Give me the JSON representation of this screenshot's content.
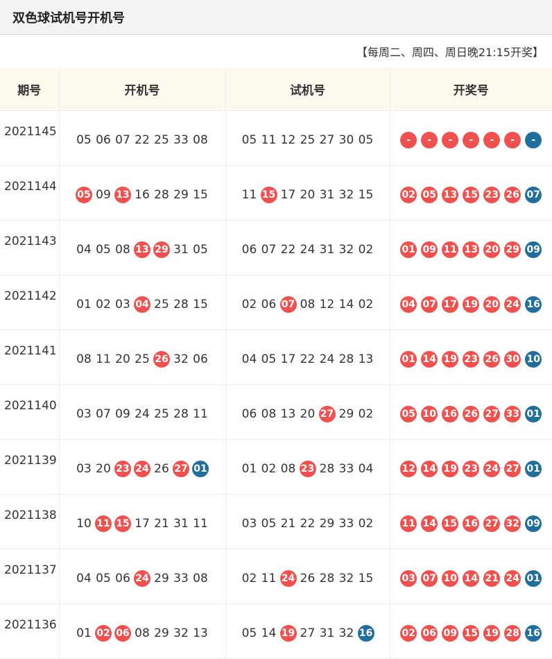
{
  "title": "双色球试机号开机号",
  "schedule": "【每周二、周四、周日晚21:15开奖】",
  "colors": {
    "red_ball": "#f0504e",
    "blue_ball": "#1f6e9b",
    "header_bg": "#fdf9ef"
  },
  "headers": [
    "期号",
    "开机号",
    "试机号",
    "开奖号"
  ],
  "rows": [
    {
      "issue": "2021145",
      "open": [
        [
          "05",
          ""
        ],
        [
          "06",
          ""
        ],
        [
          "07",
          ""
        ],
        [
          "22",
          ""
        ],
        [
          "25",
          ""
        ],
        [
          "33",
          ""
        ],
        [
          "08",
          ""
        ]
      ],
      "trial": [
        [
          "05",
          ""
        ],
        [
          "11",
          ""
        ],
        [
          "12",
          ""
        ],
        [
          "25",
          ""
        ],
        [
          "27",
          ""
        ],
        [
          "30",
          ""
        ],
        [
          "05",
          ""
        ]
      ],
      "draw": [
        [
          "-",
          "red"
        ],
        [
          "-",
          "red"
        ],
        [
          "-",
          "red"
        ],
        [
          "-",
          "red"
        ],
        [
          "-",
          "red"
        ],
        [
          "-",
          "red"
        ],
        [
          "-",
          "blue"
        ]
      ]
    },
    {
      "issue": "2021144",
      "open": [
        [
          "05",
          "red"
        ],
        [
          "09",
          ""
        ],
        [
          "13",
          "red"
        ],
        [
          "16",
          ""
        ],
        [
          "28",
          ""
        ],
        [
          "29",
          ""
        ],
        [
          "15",
          ""
        ]
      ],
      "trial": [
        [
          "11",
          ""
        ],
        [
          "15",
          "red"
        ],
        [
          "17",
          ""
        ],
        [
          "20",
          ""
        ],
        [
          "31",
          ""
        ],
        [
          "32",
          ""
        ],
        [
          "15",
          ""
        ]
      ],
      "draw": [
        [
          "02",
          "red"
        ],
        [
          "05",
          "red"
        ],
        [
          "13",
          "red"
        ],
        [
          "15",
          "red"
        ],
        [
          "23",
          "red"
        ],
        [
          "26",
          "red"
        ],
        [
          "07",
          "blue"
        ]
      ]
    },
    {
      "issue": "2021143",
      "open": [
        [
          "04",
          ""
        ],
        [
          "05",
          ""
        ],
        [
          "08",
          ""
        ],
        [
          "13",
          "red"
        ],
        [
          "29",
          "red"
        ],
        [
          "31",
          ""
        ],
        [
          "05",
          ""
        ]
      ],
      "trial": [
        [
          "06",
          ""
        ],
        [
          "07",
          ""
        ],
        [
          "22",
          ""
        ],
        [
          "24",
          ""
        ],
        [
          "31",
          ""
        ],
        [
          "32",
          ""
        ],
        [
          "02",
          ""
        ]
      ],
      "draw": [
        [
          "01",
          "red"
        ],
        [
          "09",
          "red"
        ],
        [
          "11",
          "red"
        ],
        [
          "13",
          "red"
        ],
        [
          "20",
          "red"
        ],
        [
          "29",
          "red"
        ],
        [
          "09",
          "blue"
        ]
      ]
    },
    {
      "issue": "2021142",
      "open": [
        [
          "01",
          ""
        ],
        [
          "02",
          ""
        ],
        [
          "03",
          ""
        ],
        [
          "04",
          "red"
        ],
        [
          "25",
          ""
        ],
        [
          "28",
          ""
        ],
        [
          "15",
          ""
        ]
      ],
      "trial": [
        [
          "02",
          ""
        ],
        [
          "06",
          ""
        ],
        [
          "07",
          "red"
        ],
        [
          "08",
          ""
        ],
        [
          "12",
          ""
        ],
        [
          "14",
          ""
        ],
        [
          "02",
          ""
        ]
      ],
      "draw": [
        [
          "04",
          "red"
        ],
        [
          "07",
          "red"
        ],
        [
          "17",
          "red"
        ],
        [
          "19",
          "red"
        ],
        [
          "20",
          "red"
        ],
        [
          "24",
          "red"
        ],
        [
          "16",
          "blue"
        ]
      ]
    },
    {
      "issue": "2021141",
      "open": [
        [
          "08",
          ""
        ],
        [
          "11",
          ""
        ],
        [
          "20",
          ""
        ],
        [
          "25",
          ""
        ],
        [
          "26",
          "red"
        ],
        [
          "32",
          ""
        ],
        [
          "06",
          ""
        ]
      ],
      "trial": [
        [
          "04",
          ""
        ],
        [
          "05",
          ""
        ],
        [
          "17",
          ""
        ],
        [
          "22",
          ""
        ],
        [
          "24",
          ""
        ],
        [
          "28",
          ""
        ],
        [
          "13",
          ""
        ]
      ],
      "draw": [
        [
          "01",
          "red"
        ],
        [
          "14",
          "red"
        ],
        [
          "19",
          "red"
        ],
        [
          "23",
          "red"
        ],
        [
          "26",
          "red"
        ],
        [
          "30",
          "red"
        ],
        [
          "10",
          "blue"
        ]
      ]
    },
    {
      "issue": "2021140",
      "open": [
        [
          "03",
          ""
        ],
        [
          "07",
          ""
        ],
        [
          "09",
          ""
        ],
        [
          "24",
          ""
        ],
        [
          "25",
          ""
        ],
        [
          "28",
          ""
        ],
        [
          "11",
          ""
        ]
      ],
      "trial": [
        [
          "06",
          ""
        ],
        [
          "08",
          ""
        ],
        [
          "13",
          ""
        ],
        [
          "20",
          ""
        ],
        [
          "27",
          "red"
        ],
        [
          "29",
          ""
        ],
        [
          "02",
          ""
        ]
      ],
      "draw": [
        [
          "05",
          "red"
        ],
        [
          "10",
          "red"
        ],
        [
          "16",
          "red"
        ],
        [
          "26",
          "red"
        ],
        [
          "27",
          "red"
        ],
        [
          "33",
          "red"
        ],
        [
          "01",
          "blue"
        ]
      ]
    },
    {
      "issue": "2021139",
      "open": [
        [
          "03",
          ""
        ],
        [
          "20",
          ""
        ],
        [
          "23",
          "red"
        ],
        [
          "24",
          "red"
        ],
        [
          "26",
          ""
        ],
        [
          "27",
          "red"
        ],
        [
          "01",
          "blue"
        ]
      ],
      "trial": [
        [
          "01",
          ""
        ],
        [
          "02",
          ""
        ],
        [
          "08",
          ""
        ],
        [
          "23",
          "red"
        ],
        [
          "28",
          ""
        ],
        [
          "33",
          ""
        ],
        [
          "04",
          ""
        ]
      ],
      "draw": [
        [
          "12",
          "red"
        ],
        [
          "14",
          "red"
        ],
        [
          "19",
          "red"
        ],
        [
          "23",
          "red"
        ],
        [
          "24",
          "red"
        ],
        [
          "27",
          "red"
        ],
        [
          "01",
          "blue"
        ]
      ]
    },
    {
      "issue": "2021138",
      "open": [
        [
          "10",
          ""
        ],
        [
          "11",
          "red"
        ],
        [
          "15",
          "red"
        ],
        [
          "17",
          ""
        ],
        [
          "21",
          ""
        ],
        [
          "31",
          ""
        ],
        [
          "11",
          ""
        ]
      ],
      "trial": [
        [
          "03",
          ""
        ],
        [
          "05",
          ""
        ],
        [
          "21",
          ""
        ],
        [
          "22",
          ""
        ],
        [
          "29",
          ""
        ],
        [
          "33",
          ""
        ],
        [
          "02",
          ""
        ]
      ],
      "draw": [
        [
          "11",
          "red"
        ],
        [
          "14",
          "red"
        ],
        [
          "15",
          "red"
        ],
        [
          "16",
          "red"
        ],
        [
          "27",
          "red"
        ],
        [
          "32",
          "red"
        ],
        [
          "09",
          "blue"
        ]
      ]
    },
    {
      "issue": "2021137",
      "open": [
        [
          "04",
          ""
        ],
        [
          "05",
          ""
        ],
        [
          "06",
          ""
        ],
        [
          "24",
          "red"
        ],
        [
          "29",
          ""
        ],
        [
          "33",
          ""
        ],
        [
          "08",
          ""
        ]
      ],
      "trial": [
        [
          "02",
          ""
        ],
        [
          "11",
          ""
        ],
        [
          "24",
          "red"
        ],
        [
          "26",
          ""
        ],
        [
          "28",
          ""
        ],
        [
          "32",
          ""
        ],
        [
          "15",
          ""
        ]
      ],
      "draw": [
        [
          "03",
          "red"
        ],
        [
          "07",
          "red"
        ],
        [
          "10",
          "red"
        ],
        [
          "14",
          "red"
        ],
        [
          "21",
          "red"
        ],
        [
          "24",
          "red"
        ],
        [
          "01",
          "blue"
        ]
      ]
    },
    {
      "issue": "2021136",
      "open": [
        [
          "01",
          ""
        ],
        [
          "02",
          "red"
        ],
        [
          "06",
          "red"
        ],
        [
          "08",
          ""
        ],
        [
          "29",
          ""
        ],
        [
          "32",
          ""
        ],
        [
          "13",
          ""
        ]
      ],
      "trial": [
        [
          "05",
          ""
        ],
        [
          "14",
          ""
        ],
        [
          "19",
          "red"
        ],
        [
          "27",
          ""
        ],
        [
          "31",
          ""
        ],
        [
          "32",
          ""
        ],
        [
          "16",
          "blue"
        ]
      ],
      "draw": [
        [
          "02",
          "red"
        ],
        [
          "06",
          "red"
        ],
        [
          "09",
          "red"
        ],
        [
          "15",
          "red"
        ],
        [
          "19",
          "red"
        ],
        [
          "28",
          "red"
        ],
        [
          "16",
          "blue"
        ]
      ]
    }
  ]
}
